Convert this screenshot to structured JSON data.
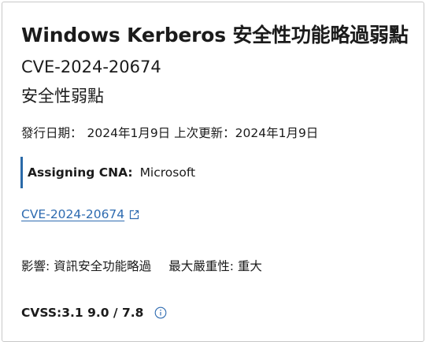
{
  "card": {
    "title": "Windows Kerberos 安全性功能略過弱點",
    "cve_id": "CVE-2024-20674",
    "vuln_type": "安全性弱點",
    "release_label": "發行日期：",
    "release_date": "2024年1月9日",
    "updated_label": "上次更新：",
    "updated_date": "2024年1月9日",
    "cna_label": "Assigning CNA:",
    "cna_value": "Microsoft",
    "link_text": "CVE-2024-20674",
    "impact_label": "影響:",
    "impact_value": "資訊安全功能略過",
    "severity_label": "最大嚴重性:",
    "severity_value": "重大",
    "cvss_label": "CVSS:3.1",
    "cvss_value": "9.0 / 7.8"
  },
  "icons": {
    "external": "external-link-icon",
    "info": "info-icon"
  },
  "colors": {
    "accent": "#2a6aa8",
    "link": "#2e6bb0",
    "border": "#c8c8c8"
  }
}
